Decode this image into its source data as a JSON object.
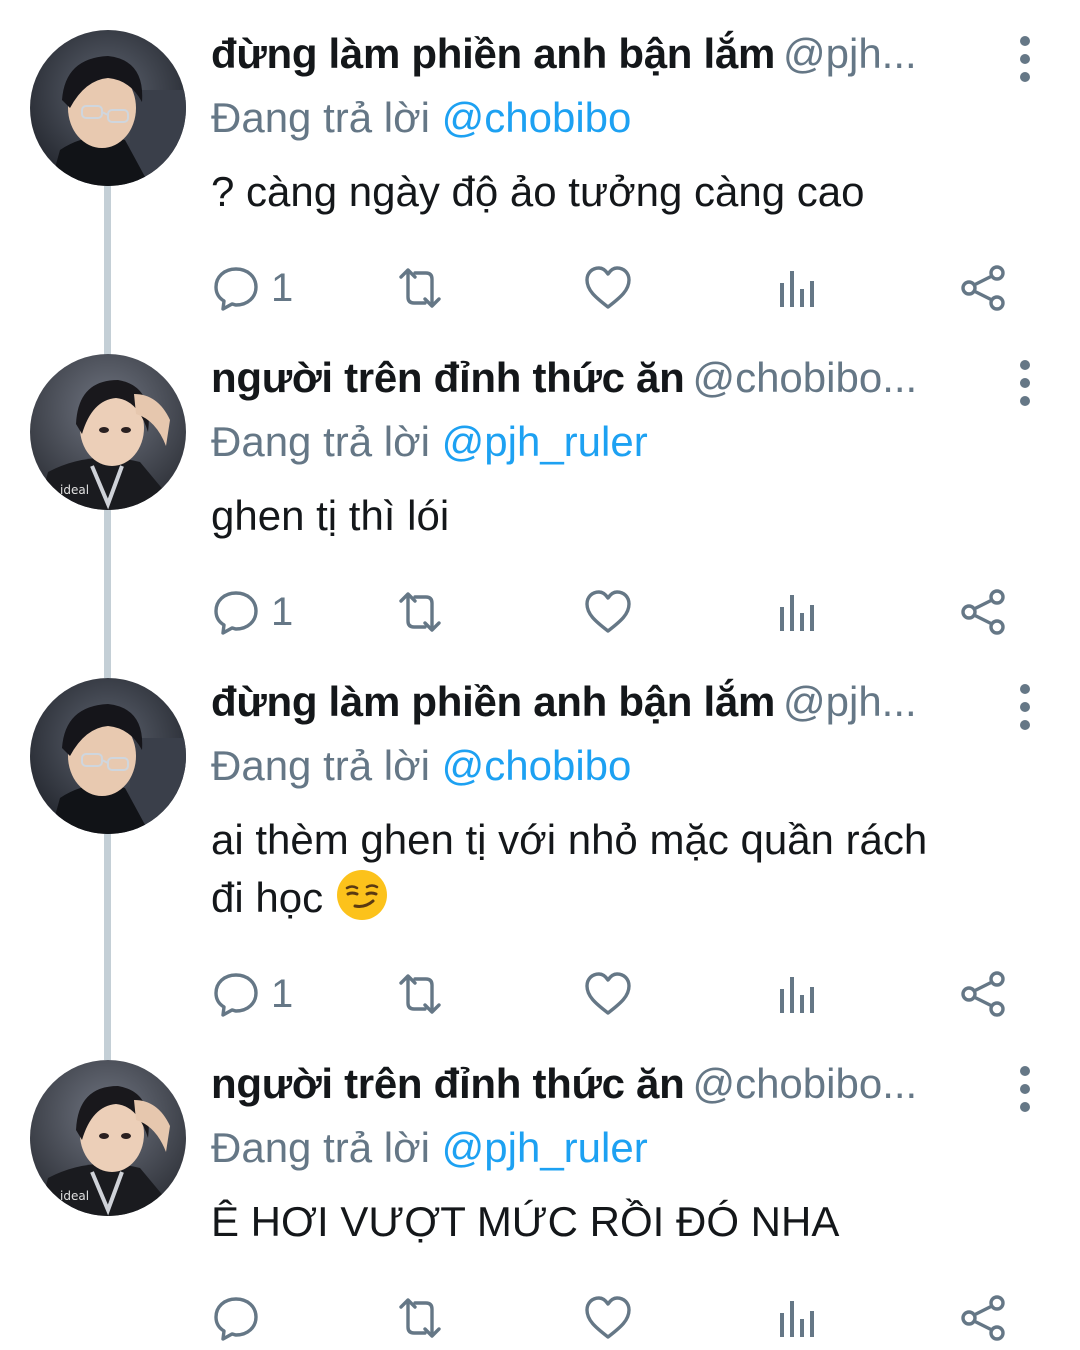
{
  "tweets": [
    {
      "name": "đừng làm phiền anh bận lắm",
      "handle": "@pjh...",
      "reply_prefix": "Đang trả lời",
      "reply_to": "@chobibo",
      "text_line1": "? càng ngày độ ảo tưởng càng cao",
      "text_line2": "",
      "reply_count": "1",
      "avatar": "avatar-photo-glasses"
    },
    {
      "name": "người trên đỉnh thức ăn",
      "handle": "@chobibo...",
      "reply_prefix": "Đang trả lời",
      "reply_to": "@pjh_ruler",
      "text_line1": "ghen tị thì lói",
      "text_line2": "",
      "reply_count": "1",
      "avatar": "avatar-photo-jersey"
    },
    {
      "name": "đừng làm phiền anh bận lắm",
      "handle": "@pjh...",
      "reply_prefix": "Đang trả lời",
      "reply_to": "@chobibo",
      "text_line1": "ai thèm ghen tị với nhỏ mặc quần rách",
      "text_line2": "đi học",
      "reply_count": "1",
      "avatar": "avatar-photo-glasses",
      "emoji": "smirking-face"
    },
    {
      "name": "người trên đỉnh thức ăn",
      "handle": "@chobibo...",
      "reply_prefix": "Đang trả lời",
      "reply_to": "@pjh_ruler",
      "text_line1": "Ê HƠI VƯỢT MỨC RỒI ĐÓ NHA",
      "text_line2": "",
      "reply_count": "",
      "avatar": "avatar-photo-jersey"
    }
  ],
  "icons": {
    "reply": "comment-bubble-icon",
    "retweet": "retweet-arrows-icon",
    "like": "heart-icon",
    "stats": "bar-chart-icon",
    "share": "share-icon",
    "more": "vertical-ellipsis-icon"
  },
  "colors": {
    "link": "#1da1f2",
    "secondary_text": "#657786",
    "primary_text": "#14171a",
    "thread_line": "#c4cfd6"
  }
}
